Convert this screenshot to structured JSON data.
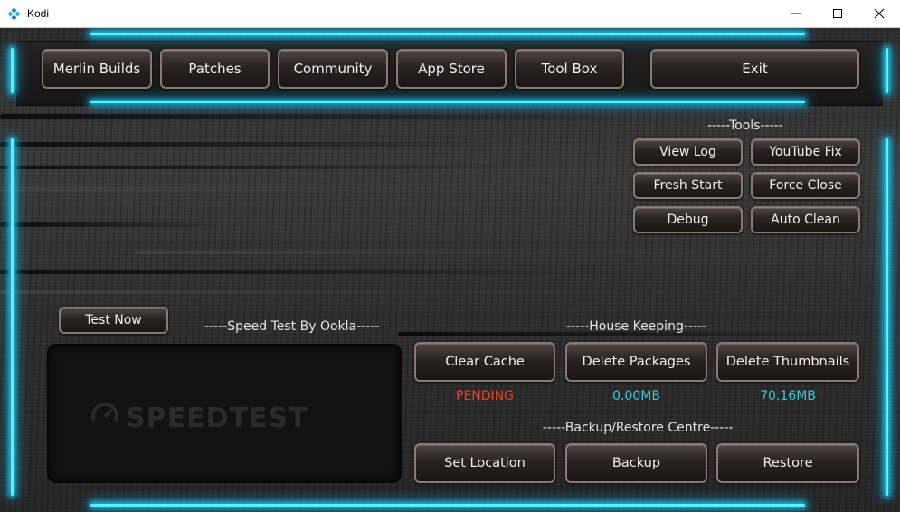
{
  "window": {
    "title": "Kodi",
    "logo_icon": "kodi-logo-icon",
    "controls": [
      "minimize-icon",
      "maximize-icon",
      "close-icon"
    ]
  },
  "nav": {
    "merlin_builds": "Merlin Builds",
    "patches": "Patches",
    "community": "Community",
    "app_store": "App Store",
    "tool_box": "Tool Box",
    "exit": "Exit"
  },
  "tools": {
    "title": "-----Tools-----",
    "view_log": "View Log",
    "youtube_fix": "YouTube Fix",
    "fresh_start": "Fresh Start",
    "force_close": "Force Close",
    "debug": "Debug",
    "auto_clean": "Auto Clean"
  },
  "speed_test": {
    "test_now": "Test Now",
    "title": "-----Speed Test By Ookla-----",
    "logo_text": "SPEEDTEST"
  },
  "house_keeping": {
    "title": "-----House Keeping-----",
    "clear_cache": "Clear Cache",
    "delete_packages": "Delete Packages",
    "delete_thumbnails": "Delete Thumbnails",
    "cache_status": "PENDING",
    "packages_size": "0.00MB",
    "thumbnails_size": "70.16MB"
  },
  "backup": {
    "title": "-----Backup/Restore Centre-----",
    "set_location": "Set Location",
    "backup": "Backup",
    "restore": "Restore"
  },
  "colors": {
    "glow": "#19c8ee",
    "pending": "#d9482f",
    "size": "#39c6d8",
    "button_border": "#8a7a70"
  }
}
